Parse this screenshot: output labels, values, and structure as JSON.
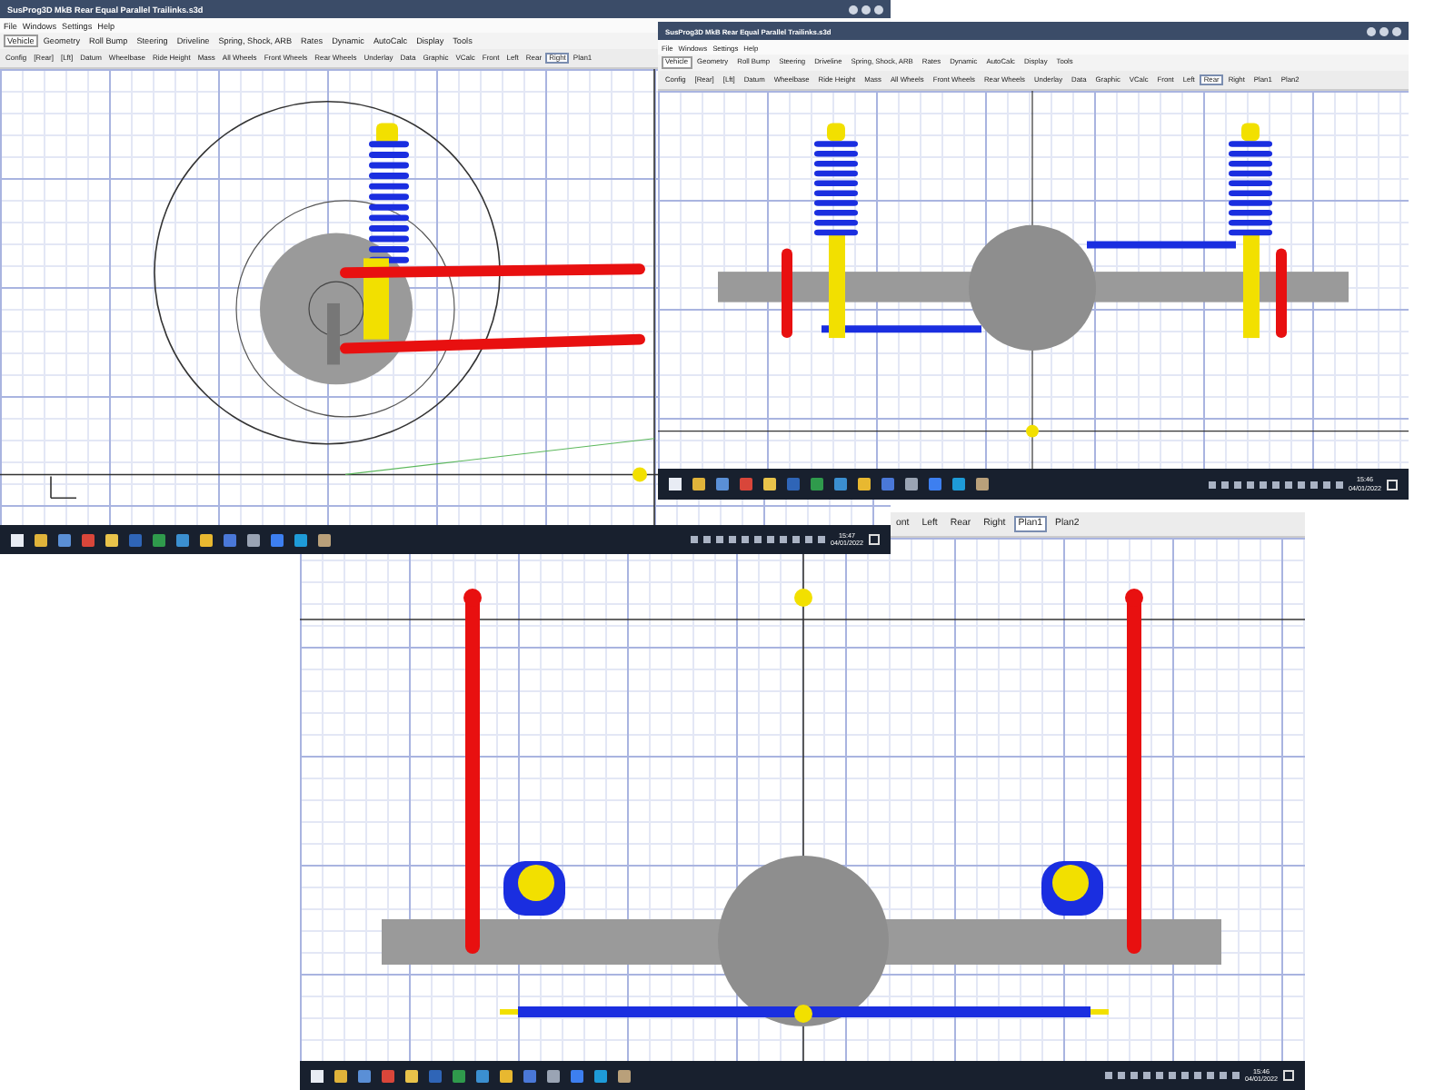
{
  "windows": [
    {
      "title": "SusProg3D MkB Rear Equal Parallel Trailinks.s3d",
      "menu": [
        "File",
        "Windows",
        "Settings",
        "Help"
      ],
      "tabs": [
        {
          "label": "Vehicle",
          "selected": true
        },
        {
          "label": "Geometry",
          "selected": false
        },
        {
          "label": "Roll Bump",
          "selected": false
        },
        {
          "label": "Steering",
          "selected": false
        },
        {
          "label": "Driveline",
          "selected": false
        },
        {
          "label": "Spring, Shock, ARB",
          "selected": false
        },
        {
          "label": "Rates",
          "selected": false
        },
        {
          "label": "Dynamic",
          "selected": false
        },
        {
          "label": "AutoCalc",
          "selected": false
        },
        {
          "label": "Display",
          "selected": false
        },
        {
          "label": "Tools",
          "selected": false
        }
      ],
      "view_tabs": [
        {
          "label": "Config",
          "selected": false
        },
        {
          "label": "[Rear]",
          "selected": false
        },
        {
          "label": "[Lft]",
          "selected": false
        },
        {
          "label": "Datum",
          "selected": false
        },
        {
          "label": "Wheelbase",
          "selected": false
        },
        {
          "label": "Ride Height",
          "selected": false
        },
        {
          "label": "Mass",
          "selected": false
        },
        {
          "label": "All Wheels",
          "selected": false
        },
        {
          "label": "Front Wheels",
          "selected": false
        },
        {
          "label": "Rear Wheels",
          "selected": false
        },
        {
          "label": "Underlay",
          "selected": false
        },
        {
          "label": "Data",
          "selected": false
        },
        {
          "label": "Graphic",
          "selected": false
        },
        {
          "label": "VCalc",
          "selected": false
        },
        {
          "label": "Front",
          "selected": false
        },
        {
          "label": "Left",
          "selected": false
        },
        {
          "label": "Rear",
          "selected": false
        },
        {
          "label": "Right",
          "selected": true
        },
        {
          "label": "Plan1",
          "selected": false
        }
      ],
      "kind": "side",
      "taskbar": {
        "time": "15:47",
        "date": "04/01/2022"
      }
    },
    {
      "title": "SusProg3D MkB Rear Equal Parallel Trailinks.s3d",
      "menu": [
        "File",
        "Windows",
        "Settings",
        "Help"
      ],
      "tabs": [
        {
          "label": "Vehicle",
          "selected": true
        },
        {
          "label": "Geometry",
          "selected": false
        },
        {
          "label": "Roll Bump",
          "selected": false
        },
        {
          "label": "Steering",
          "selected": false
        },
        {
          "label": "Driveline",
          "selected": false
        },
        {
          "label": "Spring, Shock, ARB",
          "selected": false
        },
        {
          "label": "Rates",
          "selected": false
        },
        {
          "label": "Dynamic",
          "selected": false
        },
        {
          "label": "AutoCalc",
          "selected": false
        },
        {
          "label": "Display",
          "selected": false
        },
        {
          "label": "Tools",
          "selected": false
        }
      ],
      "view_tabs": [
        {
          "label": "Config",
          "selected": false
        },
        {
          "label": "[Rear]",
          "selected": false
        },
        {
          "label": "[Lft]",
          "selected": false
        },
        {
          "label": "Datum",
          "selected": false
        },
        {
          "label": "Wheelbase",
          "selected": false
        },
        {
          "label": "Ride Height",
          "selected": false
        },
        {
          "label": "Mass",
          "selected": false
        },
        {
          "label": "All Wheels",
          "selected": false
        },
        {
          "label": "Front Wheels",
          "selected": false
        },
        {
          "label": "Rear Wheels",
          "selected": false
        },
        {
          "label": "Underlay",
          "selected": false
        },
        {
          "label": "Data",
          "selected": false
        },
        {
          "label": "Graphic",
          "selected": false
        },
        {
          "label": "VCalc",
          "selected": false
        },
        {
          "label": "Front",
          "selected": false
        },
        {
          "label": "Left",
          "selected": false
        },
        {
          "label": "Rear",
          "selected": true
        },
        {
          "label": "Right",
          "selected": false
        },
        {
          "label": "Plan1",
          "selected": false
        },
        {
          "label": "Plan2",
          "selected": false
        }
      ],
      "kind": "rear",
      "taskbar": {
        "time": "15:46",
        "date": "04/01/2022"
      }
    },
    {
      "view_tabs": [
        {
          "label": "ont",
          "selected": false
        },
        {
          "label": "Left",
          "selected": false
        },
        {
          "label": "Rear",
          "selected": false
        },
        {
          "label": "Right",
          "selected": false
        },
        {
          "label": "Plan1",
          "selected": true
        },
        {
          "label": "Plan2",
          "selected": false
        }
      ],
      "kind": "plan",
      "taskbar": {
        "time": "15:46",
        "date": "04/01/2022"
      }
    }
  ]
}
